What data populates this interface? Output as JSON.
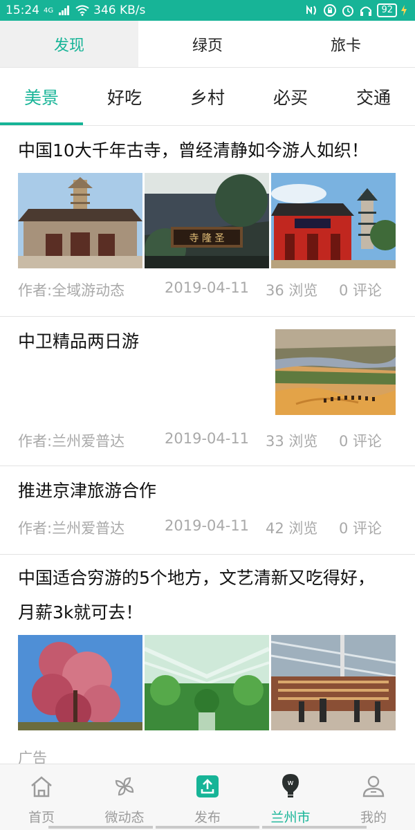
{
  "status_bar": {
    "time": "15:24",
    "network": "4G",
    "speed": "346 KB/s",
    "battery": "92",
    "accent": "#17b497"
  },
  "top_tabs": [
    {
      "label": "发现",
      "active": true
    },
    {
      "label": "绿页",
      "active": false
    },
    {
      "label": "旅卡",
      "active": false
    }
  ],
  "category_tabs": [
    {
      "label": "美景",
      "active": true
    },
    {
      "label": "好吃",
      "active": false
    },
    {
      "label": "乡村",
      "active": false
    },
    {
      "label": "必买",
      "active": false
    },
    {
      "label": "交通",
      "active": false
    }
  ],
  "articles": [
    {
      "title": "中国10大千年古寺，曾经清静如今游人如织！",
      "author": "作者:全域游动态",
      "date": "2019-04-11",
      "views": "36 浏览",
      "comments": "0 评论",
      "images": [
        "pagoda-temple-photo",
        "temple-plaque-photo",
        "red-temple-gate-photo"
      ]
    },
    {
      "title": "中卫精品两日游",
      "author": "作者:兰州爱普达",
      "date": "2019-04-11",
      "views": "33 浏览",
      "comments": "0 评论",
      "images": [
        "desert-river-photo"
      ]
    },
    {
      "title": "推进京津旅游合作",
      "author": "作者:兰州爱普达",
      "date": "2019-04-11",
      "views": "42 浏览",
      "comments": "0 评论",
      "images": []
    },
    {
      "title_line1": "中国适合穷游的5个地方，文艺清新又吃得好，",
      "title_line2": "月薪3k就可去！",
      "ad_label": "广告",
      "images": [
        "blossom-tree-photo",
        "greenhouse-photo",
        "market-hall-photo"
      ]
    }
  ],
  "bottom_nav": [
    {
      "label": "首页",
      "icon": "home-icon",
      "active": false
    },
    {
      "label": "微动态",
      "icon": "pinwheel-icon",
      "active": false
    },
    {
      "label": "发布",
      "icon": "upload-icon",
      "active": false
    },
    {
      "label": "兰州市",
      "icon": "location-bulb-icon",
      "active": true
    },
    {
      "label": "我的",
      "icon": "user-icon",
      "active": false
    }
  ]
}
